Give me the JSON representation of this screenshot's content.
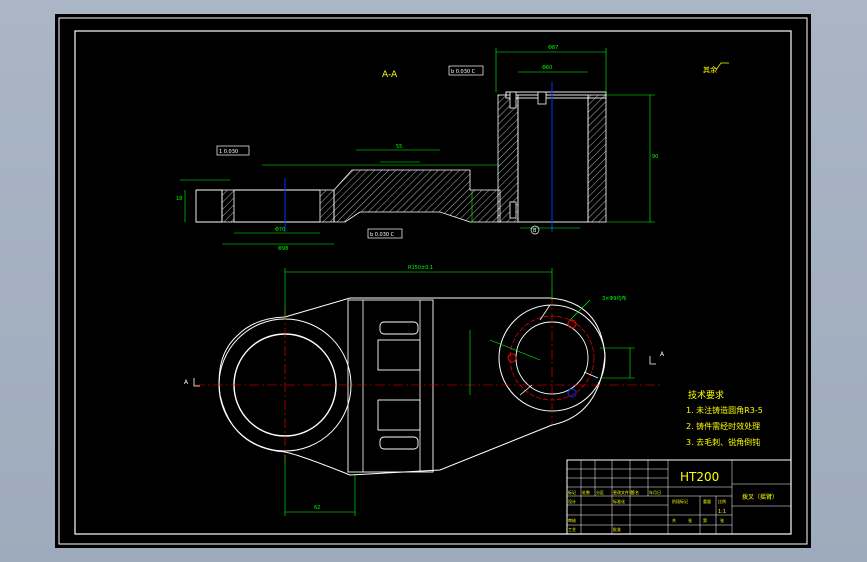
{
  "drawing": {
    "section_label": "A-A",
    "view_markers": [
      "A",
      "A"
    ],
    "roughness_note": "其余",
    "material": "HT200",
    "title_block": {
      "part_name": "拨叉（摇臂）",
      "scale": "1:1",
      "cells": [
        "标记",
        "处数",
        "分区",
        "更改文件号",
        "签名",
        "年月日",
        "设计",
        "标准化",
        "审核",
        "工艺",
        "批准",
        "阶段标记",
        "重量",
        "比例",
        "共",
        "张",
        "第",
        "张"
      ]
    },
    "requirements": {
      "title": "技术要求",
      "items": [
        "1. 未注铸造圆角R3-5",
        "2. 铸件需经时效处理",
        "3. 去毛刺、锐角倒钝"
      ]
    },
    "tolerance_frames": [
      "1 0.030",
      "b 0.030 C",
      "b 0.030 C"
    ],
    "datum_label": "B"
  },
  "colors": {
    "background": "#000000",
    "frame": "#ffffff",
    "outline": "#ffffff",
    "dimension": "#00ff00",
    "centerline": "#ff0000",
    "hidden": "#0033ff",
    "text_yellow": "#ffff00",
    "hatch": "#ffffff"
  }
}
